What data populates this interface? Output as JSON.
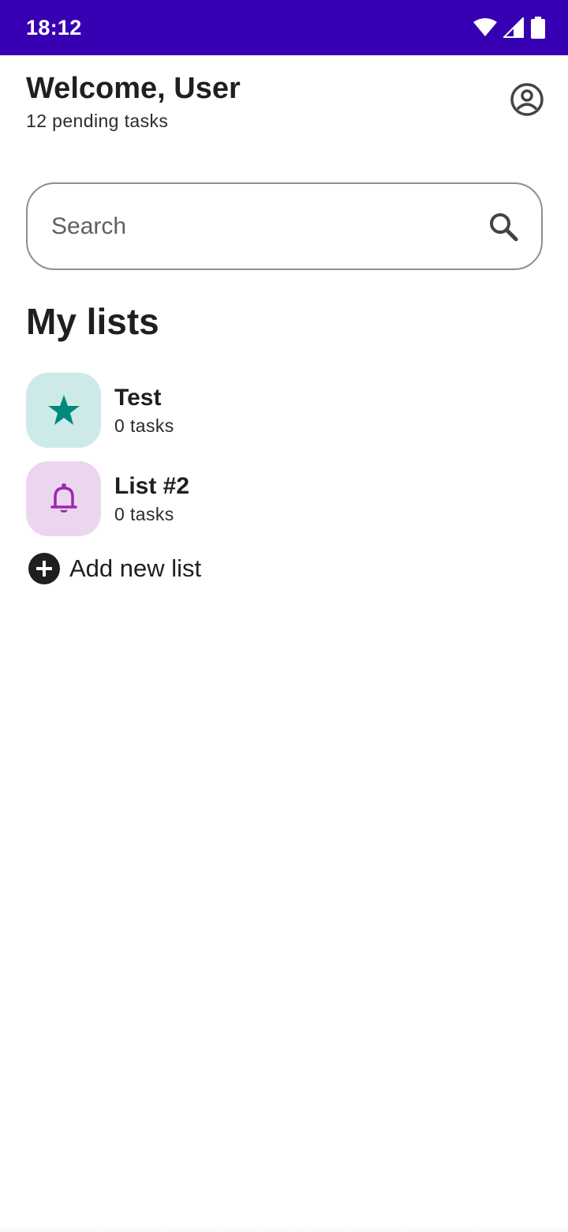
{
  "status_bar": {
    "time": "18:12",
    "icons": [
      "wifi-icon",
      "signal-icon",
      "battery-icon"
    ],
    "color": "#3700b3"
  },
  "header": {
    "title": "Welcome, User",
    "subtitle": "12 pending tasks",
    "account_icon": "account-circle-icon"
  },
  "search": {
    "placeholder": "Search",
    "value": "",
    "icon": "search-icon"
  },
  "section": {
    "title": "My lists"
  },
  "lists": [
    {
      "name": "Test",
      "count": "0 tasks",
      "icon": "star-icon",
      "icon_color": "#00897b",
      "badge_color": "#cdeae8"
    },
    {
      "name": "List #2",
      "count": "0 tasks",
      "icon": "bell-icon",
      "icon_color": "#9c27b0",
      "badge_color": "#ecd6ef"
    }
  ],
  "add_list": {
    "label": "Add new list",
    "icon": "add-circle-icon"
  }
}
